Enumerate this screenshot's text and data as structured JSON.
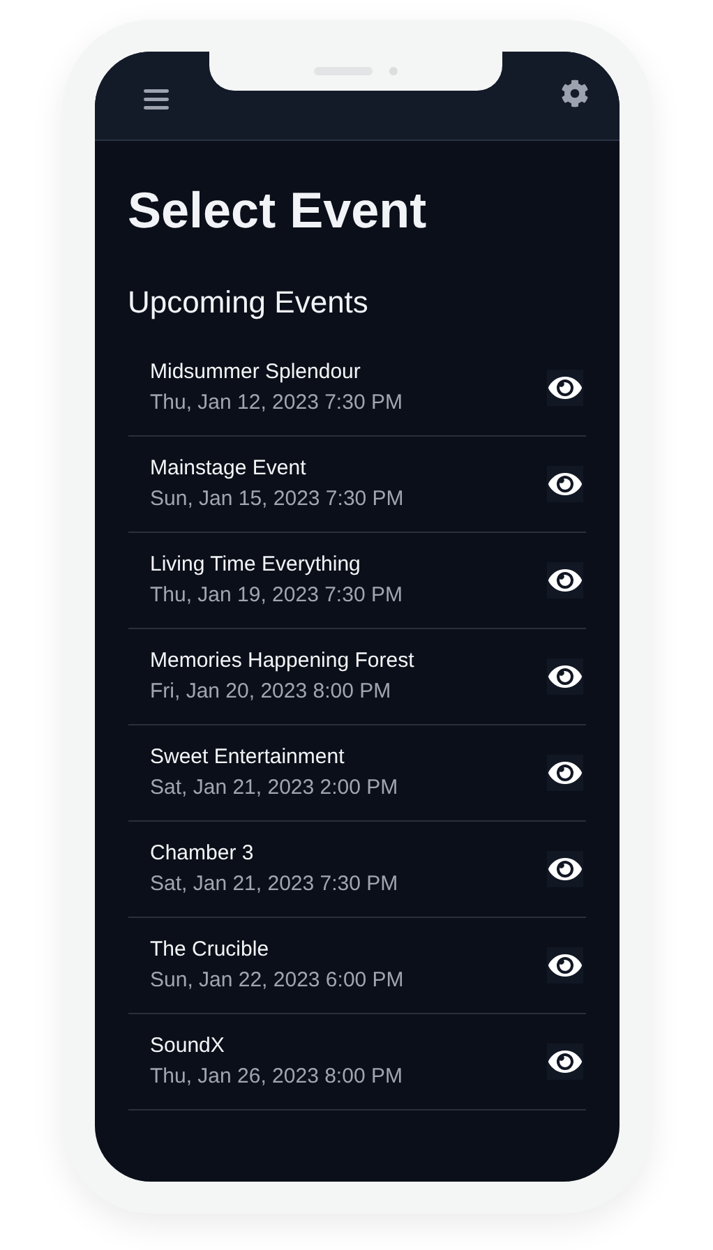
{
  "header": {
    "title": "Select Event"
  },
  "section": {
    "title": "Upcoming Events"
  },
  "events": [
    {
      "name": "Midsummer Splendour",
      "date": "Thu, Jan 12, 2023 7:30 PM"
    },
    {
      "name": "Mainstage Event",
      "date": "Sun, Jan 15, 2023 7:30 PM"
    },
    {
      "name": "Living Time Everything",
      "date": "Thu, Jan 19, 2023 7:30 PM"
    },
    {
      "name": "Memories Happening Forest",
      "date": "Fri, Jan 20, 2023 8:00 PM"
    },
    {
      "name": "Sweet Entertainment",
      "date": "Sat, Jan 21, 2023 2:00 PM"
    },
    {
      "name": "Chamber 3",
      "date": "Sat, Jan 21, 2023 7:30 PM"
    },
    {
      "name": "The Crucible",
      "date": "Sun, Jan 22, 2023 6:00 PM"
    },
    {
      "name": "SoundX",
      "date": "Thu, Jan 26, 2023 8:00 PM"
    }
  ]
}
